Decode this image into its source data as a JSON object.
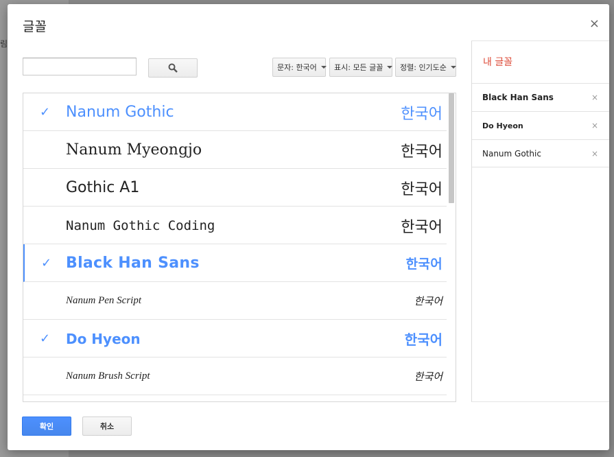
{
  "background": {
    "peek_text": "림"
  },
  "dialog": {
    "title": "글꼴",
    "close_symbol": "×"
  },
  "search": {
    "placeholder": "",
    "value": ""
  },
  "filters": {
    "script": "문자: 한국어",
    "show": "표시: 모든 글꼴",
    "sort": "정렬: 인기도순"
  },
  "fonts": [
    {
      "name": "Nanum Gothic",
      "sample": "한국어",
      "checked": "✓"
    },
    {
      "name": "Nanum Myeongjo",
      "sample": "한국어",
      "checked": ""
    },
    {
      "name": "Gothic A1",
      "sample": "한국어",
      "checked": ""
    },
    {
      "name": "Nanum Gothic Coding",
      "sample": "한국어",
      "checked": ""
    },
    {
      "name": "Black Han Sans",
      "sample": "한국어",
      "checked": "✓"
    },
    {
      "name": "Nanum Pen Script",
      "sample": "한국어",
      "checked": ""
    },
    {
      "name": "Do Hyeon",
      "sample": "한국어",
      "checked": "✓"
    },
    {
      "name": "Nanum Brush Script",
      "sample": "한국어",
      "checked": ""
    }
  ],
  "my_fonts": {
    "title": "내 글꼴",
    "items": [
      {
        "name": "Black Han Sans",
        "remove": "×"
      },
      {
        "name": "Do Hyeon",
        "remove": "×"
      },
      {
        "name": "Nanum Gothic",
        "remove": "×"
      }
    ]
  },
  "buttons": {
    "ok": "확인",
    "cancel": "취소"
  },
  "colors": {
    "accent": "#4d90fe",
    "panel_title": "#dd4b39"
  }
}
